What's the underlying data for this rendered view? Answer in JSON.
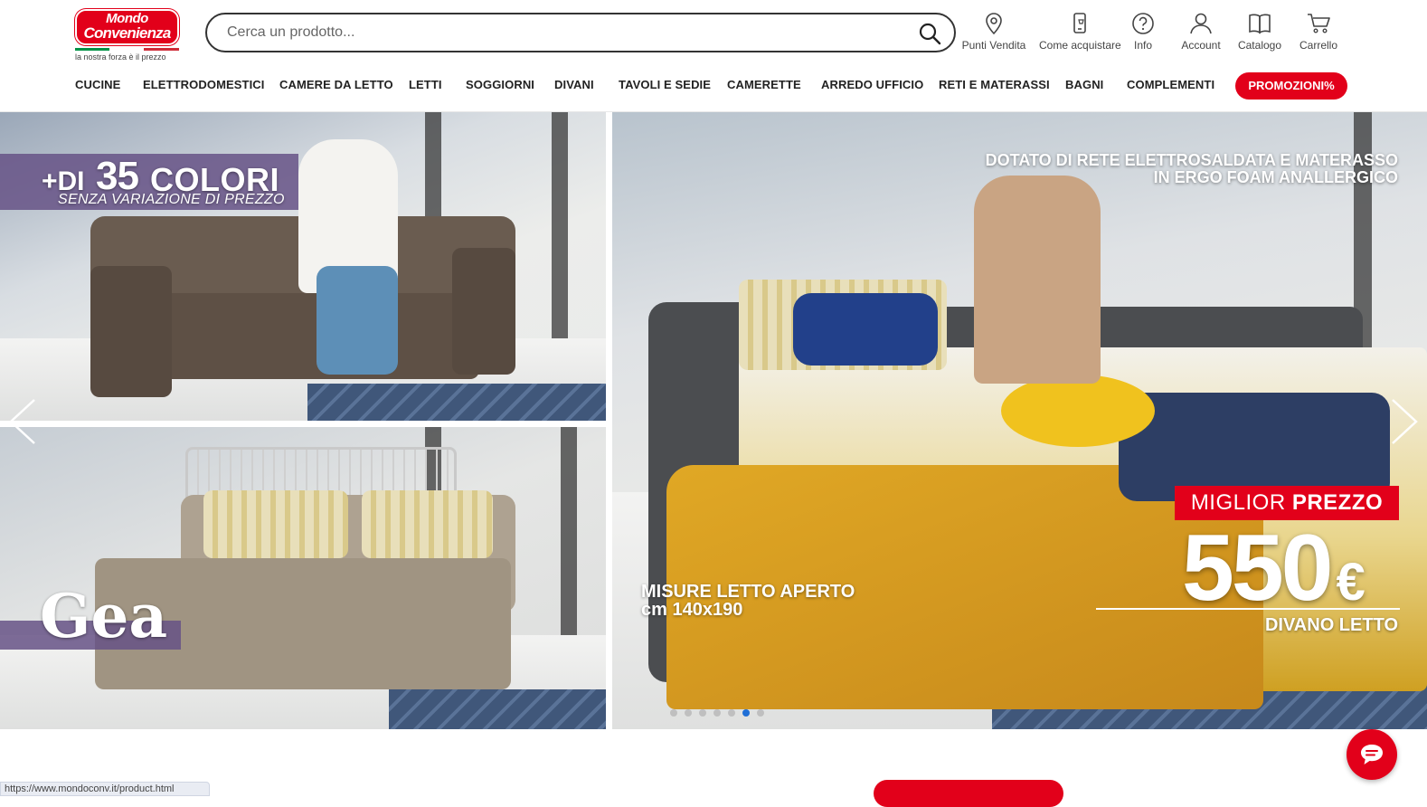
{
  "brand": {
    "logo_line1": "Mondo",
    "logo_line2": "Convenienza",
    "tagline": "la nostra forza è il prezzo",
    "red": "#e2001a"
  },
  "search": {
    "placeholder": "Cerca un prodotto...",
    "icon": "search-icon"
  },
  "header_nav": [
    {
      "label": "Punti Vendita",
      "icon": "map-pin-icon"
    },
    {
      "label": "Come acquistare",
      "icon": "phone-cart-icon"
    },
    {
      "label": "Info",
      "icon": "help-icon"
    },
    {
      "label": "Account",
      "icon": "user-icon"
    },
    {
      "label": "Catalogo",
      "icon": "catalog-book-icon"
    },
    {
      "label": "Carrello",
      "icon": "cart-icon"
    }
  ],
  "categories": [
    "CUCINE",
    "ELETTRODOMESTICI",
    "CAMERE DA LETTO",
    "LETTI",
    "SOGGIORNI",
    "DIVANI",
    "TAVOLI E SEDIE",
    "CAMERETTE",
    "ARREDO UFFICIO",
    "RETI E MATERASSI",
    "BAGNI",
    "COMPLEMENTI"
  ],
  "promo_label": "PROMOZIONI%",
  "hero": {
    "title_prefix": "+DI",
    "title_number": "35",
    "title_word": "COLORI",
    "subtitle": "SENZA VARIAZIONE DI PREZZO",
    "model_name": "Gea",
    "feature_line1": "DOTATO DI RETE ELETTROSALDATA E MATERASSO",
    "feature_line2": "IN ERGO FOAM ANALLERGICO",
    "measure_line1": "MISURE LETTO APERTO",
    "measure_line2": "cm 140x190",
    "badge_light": "MIGLIOR",
    "badge_bold": "PREZZO",
    "price": "550",
    "currency": "€",
    "product_type": "DIVANO LETTO",
    "slide_count": 7,
    "active_slide": 6
  },
  "status_url": "https://www.mondoconv.it/product.html",
  "chat_icon": "chat-icon"
}
